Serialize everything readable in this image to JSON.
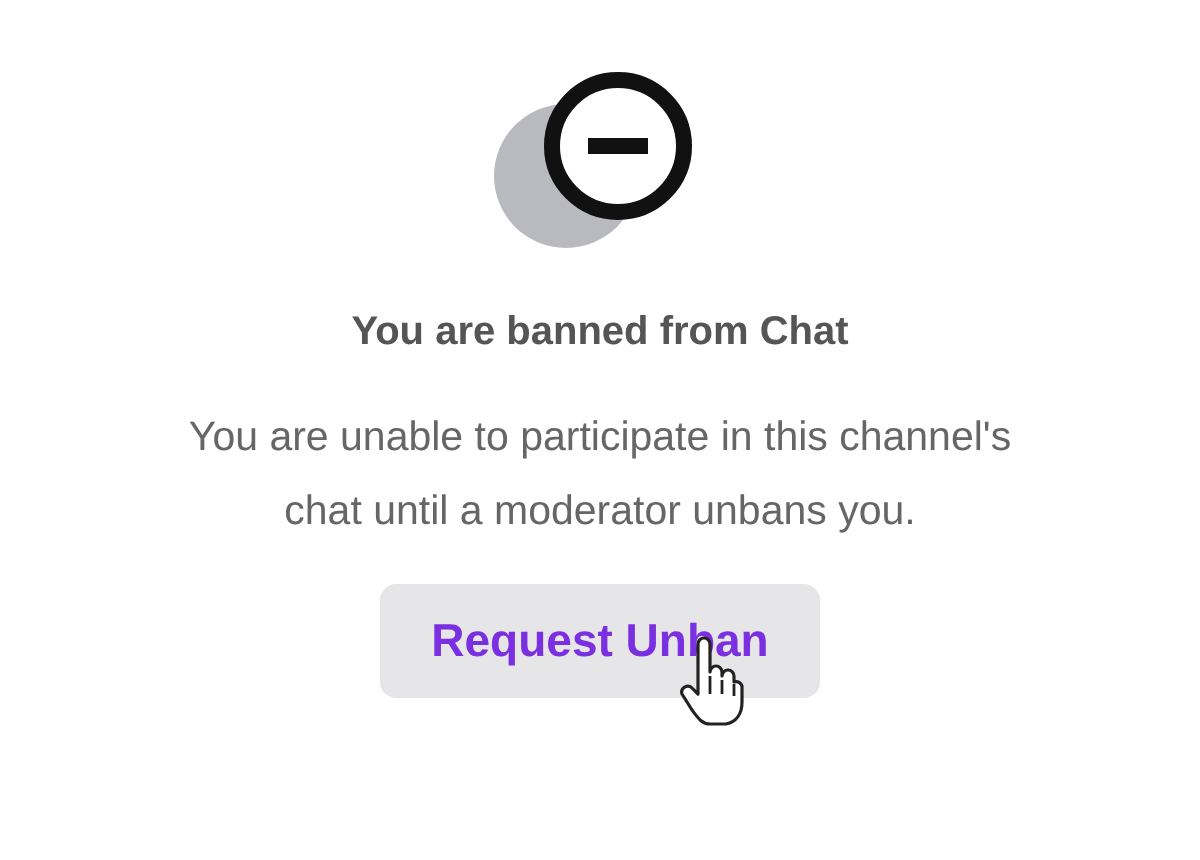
{
  "title": "You are banned from Chat",
  "message": "You are unable to participate in this channel's chat until a moderator unbans you.",
  "button": {
    "label": "Request Unban"
  }
}
